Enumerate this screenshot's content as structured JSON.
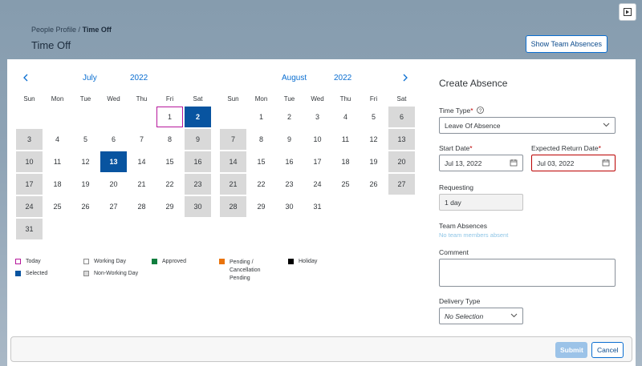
{
  "header": {
    "breadcrumb_parent": "People Profile",
    "breadcrumb_sep": " / ",
    "breadcrumb_current": "Time Off",
    "title": "Time Off",
    "show_team_label": "Show Team Absences"
  },
  "calendar_left": {
    "month": "July",
    "year": "2022",
    "weekdays": [
      "Sun",
      "Mon",
      "Tue",
      "Wed",
      "Thu",
      "Fri",
      "Sat"
    ],
    "leading_blanks": 5,
    "days": [
      "1",
      "2",
      "3",
      "4",
      "5",
      "6",
      "7",
      "8",
      "9",
      "10",
      "11",
      "12",
      "13",
      "14",
      "15",
      "16",
      "17",
      "18",
      "19",
      "20",
      "21",
      "22",
      "23",
      "24",
      "25",
      "26",
      "27",
      "28",
      "29",
      "30",
      "31"
    ],
    "today": "1",
    "selected": [
      "2",
      "13"
    ]
  },
  "calendar_right": {
    "month": "August",
    "year": "2022",
    "weekdays": [
      "Sun",
      "Mon",
      "Tue",
      "Wed",
      "Thu",
      "Fri",
      "Sat"
    ],
    "leading_blanks": 1,
    "days": [
      "1",
      "2",
      "3",
      "4",
      "5",
      "6",
      "7",
      "8",
      "9",
      "10",
      "11",
      "12",
      "13",
      "14",
      "15",
      "16",
      "17",
      "18",
      "19",
      "20",
      "21",
      "22",
      "23",
      "24",
      "25",
      "26",
      "27",
      "28",
      "29",
      "30",
      "31"
    ],
    "today": "",
    "selected": []
  },
  "legend": {
    "today": "Today",
    "selected": "Selected",
    "working_day": "Working Day",
    "non_working_day": "Non-Working Day",
    "approved": "Approved",
    "pending": "Pending / Cancellation Pending",
    "holiday": "Holiday",
    "colors": {
      "today": "#b6179b",
      "selected": "#0854a0",
      "working_day": "#ffffff",
      "non_working_day": "#d9d9d9",
      "approved": "#107e3e",
      "pending": "#e9730c",
      "holiday": "#000000"
    }
  },
  "form": {
    "title": "Create Absence",
    "time_type_label": "Time Type",
    "time_type_value": "Leave Of Absence",
    "start_date_label": "Start Date",
    "start_date_value": "Jul 13, 2022",
    "return_date_label": "Expected Return Date",
    "return_date_value": "Jul 03, 2022",
    "requesting_label": "Requesting",
    "requesting_value": "1 day",
    "team_absences_label": "Team Absences",
    "team_absences_value": "No team members absent",
    "comment_label": "Comment",
    "comment_value": "",
    "delivery_type_label": "Delivery Type",
    "delivery_type_value": "No Selection",
    "required_marker": "*"
  },
  "footer": {
    "submit_label": "Submit",
    "cancel_label": "Cancel"
  },
  "icons": {
    "corner": "expand-icon",
    "prev": "chevron-left-icon",
    "next": "chevron-right-icon",
    "calendar": "calendar-icon",
    "dropdown": "chevron-down-icon",
    "help": "help-icon"
  }
}
